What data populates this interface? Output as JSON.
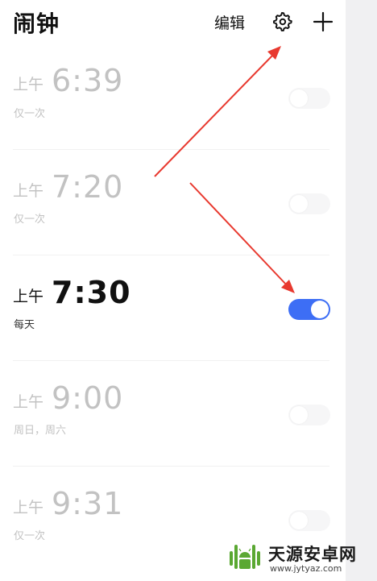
{
  "header": {
    "title": "闹钟",
    "edit_label": "编辑",
    "settings_icon": "gear-icon",
    "add_icon": "plus-icon"
  },
  "alarms": [
    {
      "period": "上午",
      "time": "6:39",
      "repeat": "仅一次",
      "enabled": false
    },
    {
      "period": "上午",
      "time": "7:20",
      "repeat": "仅一次",
      "enabled": false
    },
    {
      "period": "上午",
      "time": "7:30",
      "repeat": "每天",
      "enabled": true
    },
    {
      "period": "上午",
      "time": "9:00",
      "repeat": "周日，周六",
      "enabled": false
    },
    {
      "period": "上午",
      "time": "9:31",
      "repeat": "仅一次",
      "enabled": false
    }
  ],
  "annotation": {
    "arrow_color": "#e8392f"
  },
  "colors": {
    "toggle_on": "#3d6ef5",
    "toggle_off": "#f6f6f7",
    "text_disabled": "#c2c2c2",
    "text_primary": "#111111"
  },
  "watermark": {
    "name": "天源安卓网",
    "url": "www.jytyaz.com",
    "logo_icon": "android-logo-icon"
  }
}
